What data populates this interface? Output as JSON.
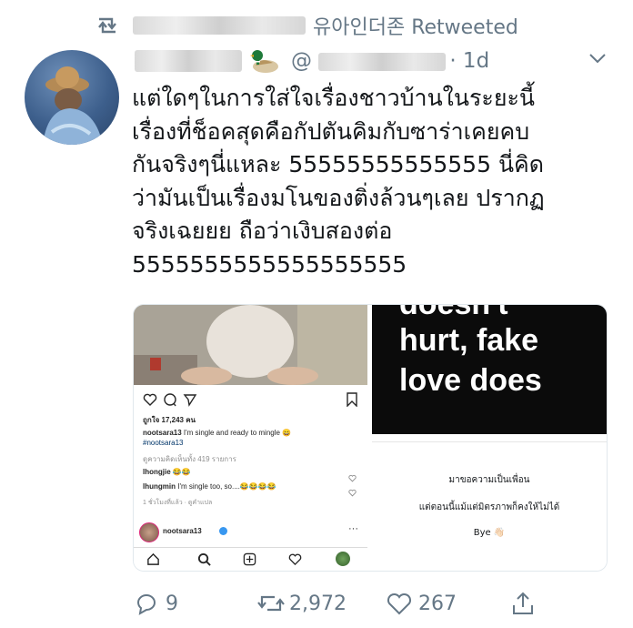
{
  "retweet": {
    "label": "유아인더존 Retweeted"
  },
  "tweet": {
    "handle_prefix": "@",
    "time": "· 1d",
    "text": "แต่ใดๆในการใส่ใจเรื่องชาวบ้านในระยะนี้\nเรื่องที่ช็อคสุดคือกัปตันคิมกับซาร่าเคยคบ\nกันจริงๆนี่แหละ 55555555555555 นี่คิด\nว่ามันเป็นเรื่องมโนของติ่งล้วนๆเลย ปรากฏ\nจริงเฉยยย ถือว่าเงิบสองต่อ\n5555555555555555555"
  },
  "media": {
    "ig": {
      "likes": "ถูกใจ 17,243 คน",
      "caption_user": "nootsara13",
      "caption": " I'm single and ready to mingle 😄",
      "hashtag": "#nootsara13",
      "view_comments": "ดูความคิดเห็นทั้ง 419 รายการ",
      "comment1_user": "lhongjie",
      "comment1": " 😂😂",
      "comment2_user": "lhungmin",
      "comment2": " I'm single too, so....😂😂😂😂",
      "time": "1 ชั่วโมงที่แล้ว · ดูคำแปล",
      "profile_user": "nootsara13"
    },
    "dark": {
      "line0": "doesn't",
      "line1": "hurt, fake",
      "line2": "love does"
    },
    "note": {
      "line1": "มาขอความเป็นเพื่อน",
      "line2": "แต่ตอนนี้แม้แต่มิตรภาพก็คงให้ไม่ได้",
      "line3": "Bye 👋🏻"
    }
  },
  "actions": {
    "replies": "9",
    "retweets": "2,972",
    "likes": "267"
  }
}
